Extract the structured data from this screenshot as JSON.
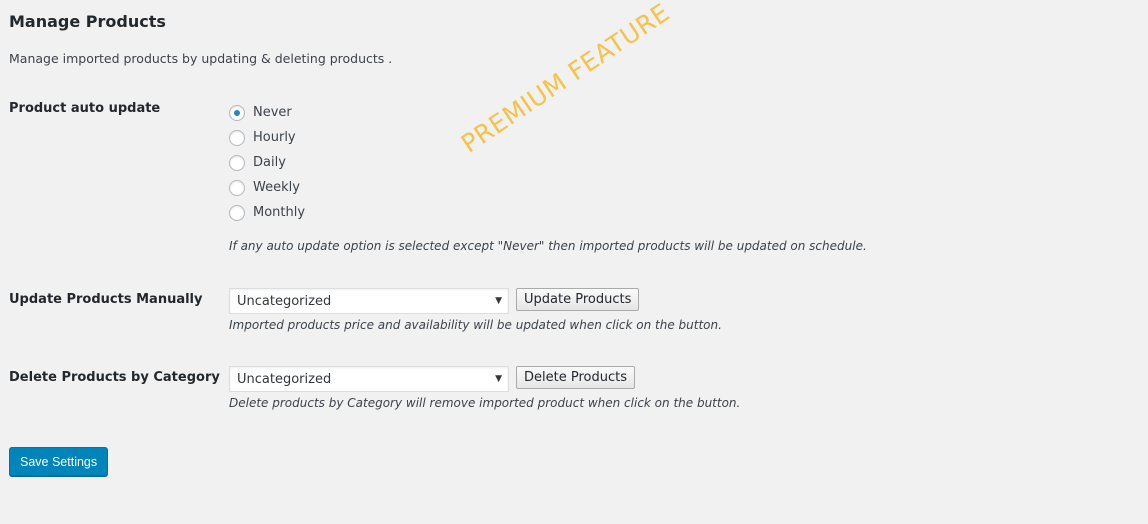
{
  "page": {
    "title": "Manage Products",
    "description": "Manage imported products by updating & deleting products ."
  },
  "auto_update": {
    "label": "Product auto update",
    "options": [
      "Never",
      "Hourly",
      "Daily",
      "Weekly",
      "Monthly"
    ],
    "selected": "Never",
    "hint": "If any auto update option is selected except \"Never\" then imported products will be updated on schedule."
  },
  "watermark": "PREMIUM FEATURE",
  "update_manual": {
    "label": "Update Products Manually",
    "select_value": "Uncategorized",
    "button_label": "Update Products",
    "hint": "Imported products price and availability will be updated when click on the button."
  },
  "delete_category": {
    "label": "Delete Products by Category",
    "select_value": "Uncategorized",
    "button_label": "Delete Products",
    "hint": "Delete products by Category will remove imported product when click on the button."
  },
  "save_label": "Save Settings",
  "colors": {
    "primary": "#0085ba",
    "watermark": "#f5c24a",
    "radio_selected": "#1e8cbe"
  }
}
